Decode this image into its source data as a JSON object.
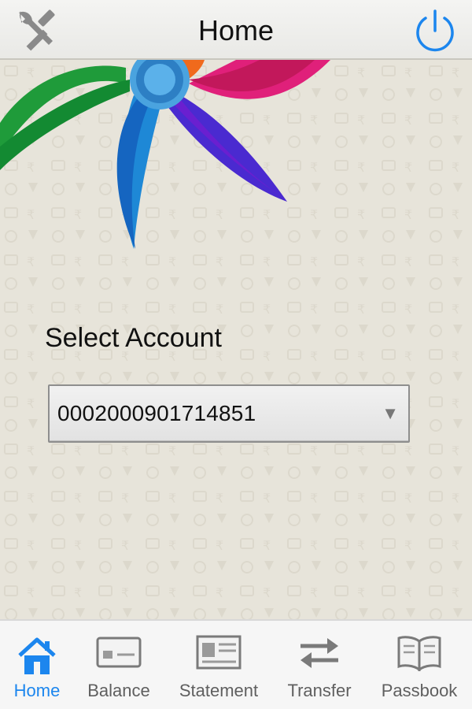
{
  "header": {
    "title": "Home",
    "left_icon": "settings-icon",
    "right_icon": "power-icon"
  },
  "main": {
    "select_label": "Select Account",
    "account_select": {
      "value": "0002000901714851",
      "arrow": "▼"
    }
  },
  "bottom_nav": {
    "items": [
      {
        "label": "Home",
        "icon": "home-icon",
        "active": true
      },
      {
        "label": "Balance",
        "icon": "card-icon",
        "active": false
      },
      {
        "label": "Statement",
        "icon": "statement-icon",
        "active": false
      },
      {
        "label": "Transfer",
        "icon": "transfer-icon",
        "active": false
      },
      {
        "label": "Passbook",
        "icon": "book-icon",
        "active": false
      }
    ]
  },
  "colors": {
    "accent": "#1c86ee",
    "background": "#e7e4da",
    "nav_inactive": "#5f5f5f"
  }
}
